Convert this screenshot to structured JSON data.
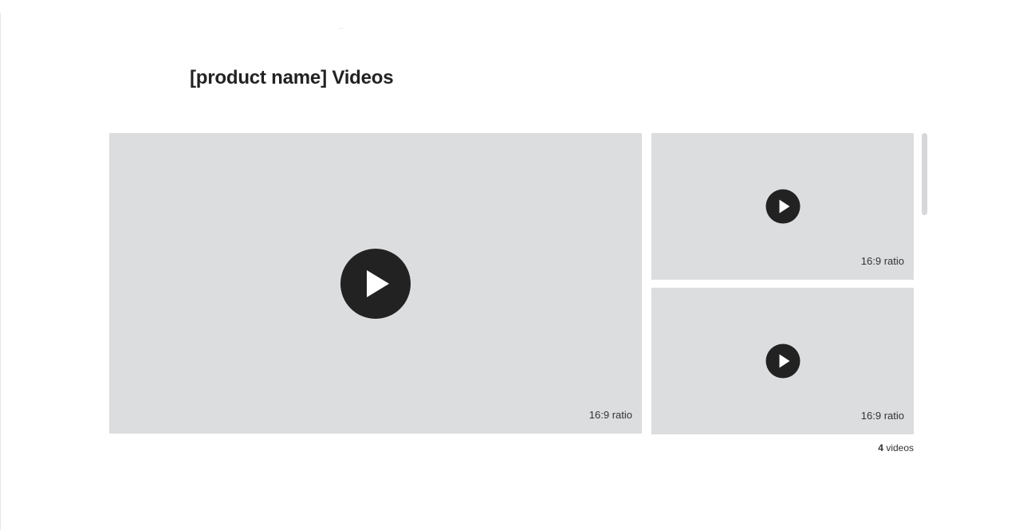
{
  "section": {
    "title": "[product name] Videos"
  },
  "videos": [
    {
      "ratio_label": "16:9 ratio",
      "icon": "play-icon"
    },
    {
      "ratio_label": "16:9 ratio",
      "icon": "play-icon"
    },
    {
      "ratio_label": "16:9 ratio",
      "icon": "play-icon"
    }
  ],
  "footer": {
    "count": "4",
    "count_suffix": "videos"
  },
  "colors": {
    "placeholder": "#dcdddf",
    "play_button": "#222222",
    "text": "#222222"
  }
}
